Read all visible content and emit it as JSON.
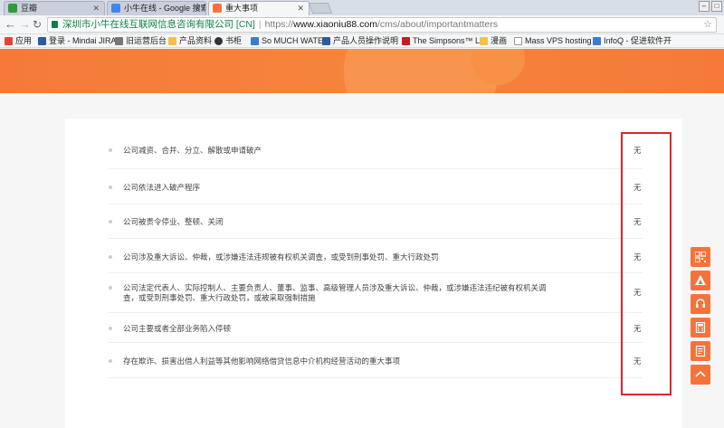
{
  "browser": {
    "tabs": [
      {
        "title": "豆瓣",
        "favicon_color": "#2f9b3a"
      },
      {
        "title": "小牛在线 - Google 搜索",
        "favicon_color": "#4285f4"
      },
      {
        "title": "重大事项",
        "favicon_color": "#f5733a"
      }
    ],
    "window_controls": [
      "–",
      "□"
    ],
    "address": {
      "secure_label": "深圳市小牛在线互联网信息咨询有限公司 [CN]",
      "separator": "|",
      "url_scheme": "https://",
      "url_host": "www.xiaoniu88.com",
      "url_path": "/cms/about/importantmatters"
    },
    "bookmarks": [
      {
        "label": "应用",
        "color": "#e94235"
      },
      {
        "label": "登录 - Mindai JIRA",
        "color": "#2c5aa0"
      },
      {
        "label": "旧运营后台",
        "color": "#777"
      },
      {
        "label": "产品资料",
        "color": "#f2c14e"
      },
      {
        "label": "书柜",
        "color": "#333"
      },
      {
        "label": "So MUCH WATER",
        "color": "#3a7bd5"
      },
      {
        "label": "产品人员操作说明",
        "color": "#2c5aa0"
      },
      {
        "label": "The Simpsons™ Li",
        "color": "#c41e1e"
      },
      {
        "label": "漫画",
        "color": "#f2c14e"
      },
      {
        "label": "Mass VPS hosting",
        "color": "#999"
      },
      {
        "label": "InfoQ - 促进软件开",
        "color": "#3a7bd5"
      }
    ]
  },
  "matters": [
    {
      "text": "公司减资、合并、分立、解散或申请破产",
      "value": "无"
    },
    {
      "text": "公司依法进入破产程序",
      "value": "无"
    },
    {
      "text": "公司被责令停业、整顿、关闭",
      "value": "无"
    },
    {
      "text": "公司涉及重大诉讼、仲裁，或涉嫌违法违规被有权机关调查，或受到刑事处罚、重大行政处罚",
      "value": "无"
    },
    {
      "text": "公司法定代表人、实际控制人、主要负责人、董事、监事、高级管理人员涉及重大诉讼、仲裁，或涉嫌违法违纪被有权机关调查，或受到刑事处罚、重大行政处罚，或被采取强制措施",
      "value": "无"
    },
    {
      "text": "公司主要或者全部业务陷入停顿",
      "value": "无"
    },
    {
      "text": "存在欺诈、损害出借人利益等其他影响网络借贷信息中介机构经营活动的重大事项",
      "value": "无"
    }
  ],
  "float_icons": [
    "qrcode-icon",
    "app-icon",
    "customer-service-icon",
    "calculator-icon",
    "notes-icon",
    "back-to-top-icon"
  ],
  "colors": {
    "accent": "#f5733a",
    "highlight": "#e0242e"
  }
}
